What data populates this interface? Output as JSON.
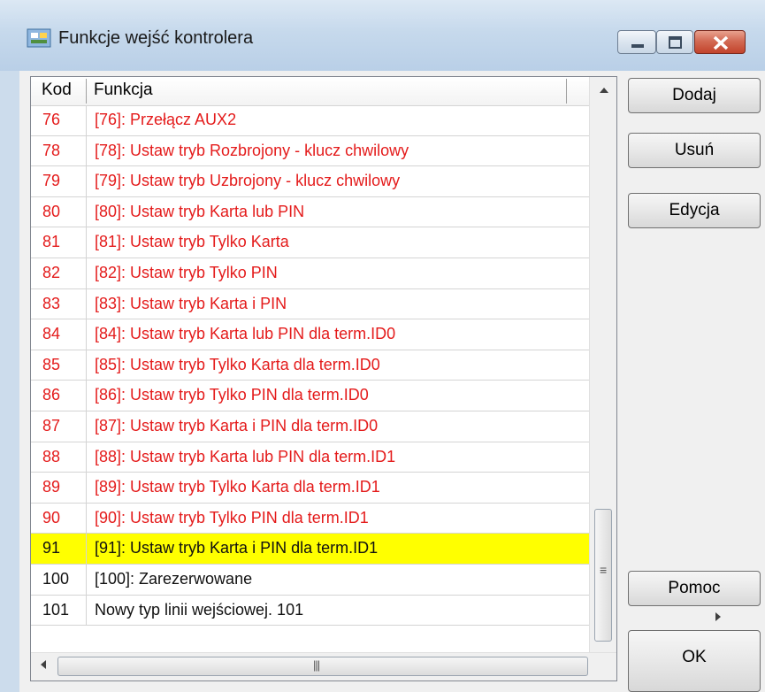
{
  "window": {
    "title": "Funkcje wejść kontrolera"
  },
  "list": {
    "headers": {
      "code": "Kod",
      "function": "Funkcja"
    },
    "rows": [
      {
        "code": "76",
        "function": "[76]: Przełącz AUX2",
        "style": "red"
      },
      {
        "code": "78",
        "function": "[78]: Ustaw tryb Rozbrojony - klucz chwilowy",
        "style": "red"
      },
      {
        "code": "79",
        "function": "[79]: Ustaw tryb Uzbrojony - klucz chwilowy",
        "style": "red"
      },
      {
        "code": "80",
        "function": "[80]: Ustaw tryb Karta lub PIN",
        "style": "red"
      },
      {
        "code": "81",
        "function": "[81]: Ustaw tryb Tylko Karta",
        "style": "red"
      },
      {
        "code": "82",
        "function": "[82]: Ustaw tryb Tylko PIN",
        "style": "red"
      },
      {
        "code": "83",
        "function": "[83]: Ustaw tryb Karta i PIN",
        "style": "red"
      },
      {
        "code": "84",
        "function": "[84]: Ustaw tryb Karta lub PIN dla term.ID0",
        "style": "red"
      },
      {
        "code": "85",
        "function": "[85]: Ustaw tryb Tylko Karta dla term.ID0",
        "style": "red"
      },
      {
        "code": "86",
        "function": "[86]: Ustaw tryb Tylko PIN dla term.ID0",
        "style": "red"
      },
      {
        "code": "87",
        "function": "[87]: Ustaw tryb Karta i PIN dla term.ID0",
        "style": "red"
      },
      {
        "code": "88",
        "function": "[88]: Ustaw tryb Karta lub PIN dla term.ID1",
        "style": "red"
      },
      {
        "code": "89",
        "function": "[89]: Ustaw tryb Tylko Karta dla term.ID1",
        "style": "red"
      },
      {
        "code": "90",
        "function": "[90]: Ustaw tryb Tylko PIN dla term.ID1",
        "style": "red"
      },
      {
        "code": "91",
        "function": "[91]: Ustaw tryb Karta i PIN dla term.ID1",
        "style": "sel"
      },
      {
        "code": "100",
        "function": "[100]: Zarezerwowane",
        "style": "black"
      },
      {
        "code": "101",
        "function": "Nowy typ linii wejściowej. 101",
        "style": "black"
      }
    ]
  },
  "buttons": {
    "add": "Dodaj",
    "delete": "Usuń",
    "edit": "Edycja",
    "help": "Pomoc",
    "ok": "OK"
  },
  "icons": {
    "app": "app-icon",
    "minimize": "minimize-icon",
    "maximize": "maximize-icon",
    "close": "close-icon",
    "scroll_up": "chevron-up-icon",
    "scroll_left": "chevron-left-icon",
    "scroll_right": "chevron-right-icon"
  },
  "colors": {
    "row_red": "#e41b1b",
    "selected_row": "#ffff00"
  }
}
